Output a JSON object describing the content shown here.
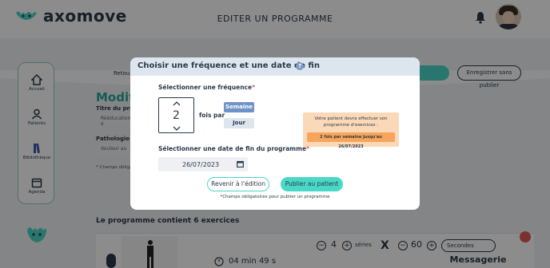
{
  "app": {
    "brand": "axomove",
    "page_title": "EDITER UN PROGRAMME"
  },
  "sidebar": {
    "items": [
      {
        "label": "Accueil",
        "icon": "home-icon"
      },
      {
        "label": "Patients",
        "icon": "user-icon"
      },
      {
        "label": "Bibliothèque",
        "icon": "library-icon"
      },
      {
        "label": "Agenda",
        "icon": "calendar-icon"
      }
    ]
  },
  "background": {
    "back_link": "Retour",
    "heading": "Modifi",
    "title_label": "Titre du progr",
    "title_value": "Rééducation é",
    "pathology_label": "Pathologie",
    "pathology_value": "douleur au",
    "required_note": "* Champs obliga",
    "save_button": "Enregistrer sans publier",
    "exercise_count": "Le programme contient 6 exercices",
    "duration": "04 min 49 s",
    "series_label": "séries",
    "series_value": "4",
    "times_symbol": "X",
    "reps_value": "60",
    "unit_select": "Secondes",
    "messaging": "Messagerie"
  },
  "modal": {
    "title": "Choisir une fréquence et une date de fin",
    "help": "?",
    "frequency_label": "Sélectionner une fréquence",
    "required_mark": "*",
    "frequency_value": "2",
    "times_per": "fois par",
    "option_week": "Semaine",
    "option_day": "Jour",
    "selected_option": "Semaine",
    "summary_text": "Votre patient devra effectuer son programme d'exercices :",
    "summary_pill": "2 fois par semaine jusqu'au 26/07/2023",
    "end_date_label": "Sélectionner une date de fin du programme",
    "end_date_value": "26/07/2023",
    "back_button": "Revenir à l'édition",
    "publish_button": "Publier au patient",
    "footnote": "*Champs obligatoires pour publier un programme"
  },
  "colors": {
    "accent_teal": "#4ad8c6",
    "primary_blue": "#6f93c8",
    "summary_bg": "#fbd9b8",
    "summary_pill": "#f7a55a",
    "required_red": "#e05a5a",
    "text_dark": "#2a3a4a"
  }
}
